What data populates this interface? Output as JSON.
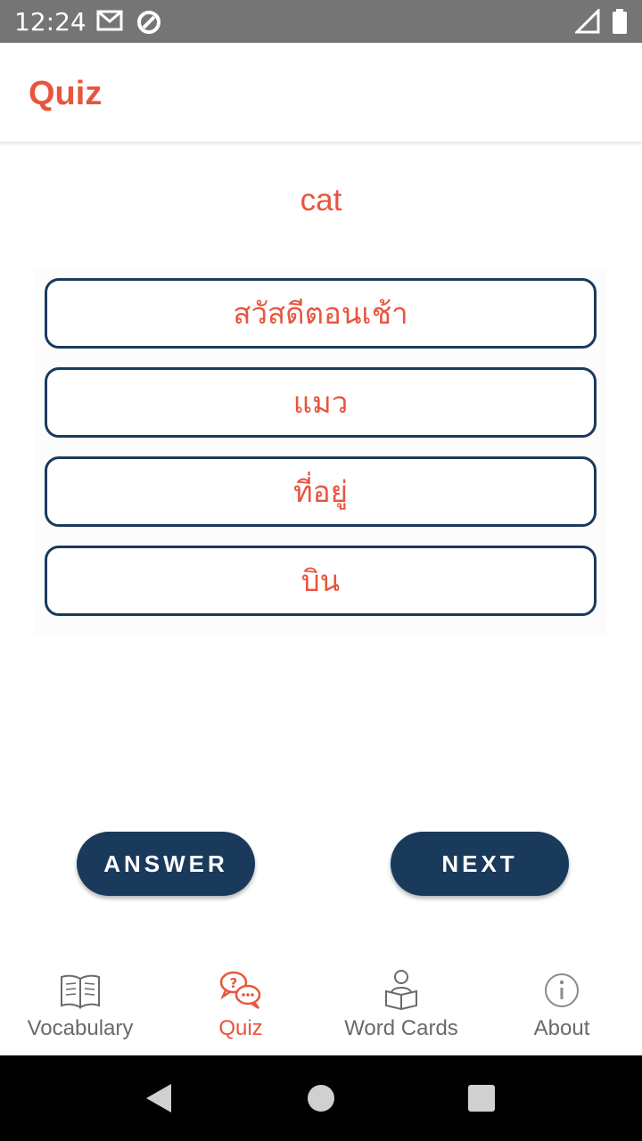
{
  "status_bar": {
    "time": "12:24",
    "icons": [
      "gmail-icon",
      "sync-icon",
      "signal-icon",
      "battery-icon"
    ]
  },
  "app_bar": {
    "title": "Quiz"
  },
  "quiz": {
    "question": "cat",
    "options": [
      {
        "label": "สวัสดีตอนเช้า"
      },
      {
        "label": "แมว"
      },
      {
        "label": "ที่อยู่"
      },
      {
        "label": "บิน"
      }
    ]
  },
  "actions": {
    "answer_label": "ANSWER",
    "next_label": "NEXT"
  },
  "bottom_nav": {
    "active": "Quiz",
    "items": [
      {
        "label": "Vocabulary",
        "icon": "book-icon"
      },
      {
        "label": "Quiz",
        "icon": "quiz-chat-icon"
      },
      {
        "label": "Word Cards",
        "icon": "reader-icon"
      },
      {
        "label": "About",
        "icon": "info-icon"
      }
    ]
  },
  "colors": {
    "accent": "#e8553d",
    "primary": "#1a3a5c",
    "status_bar": "#757575",
    "nav_inactive": "#6a6a6a"
  }
}
